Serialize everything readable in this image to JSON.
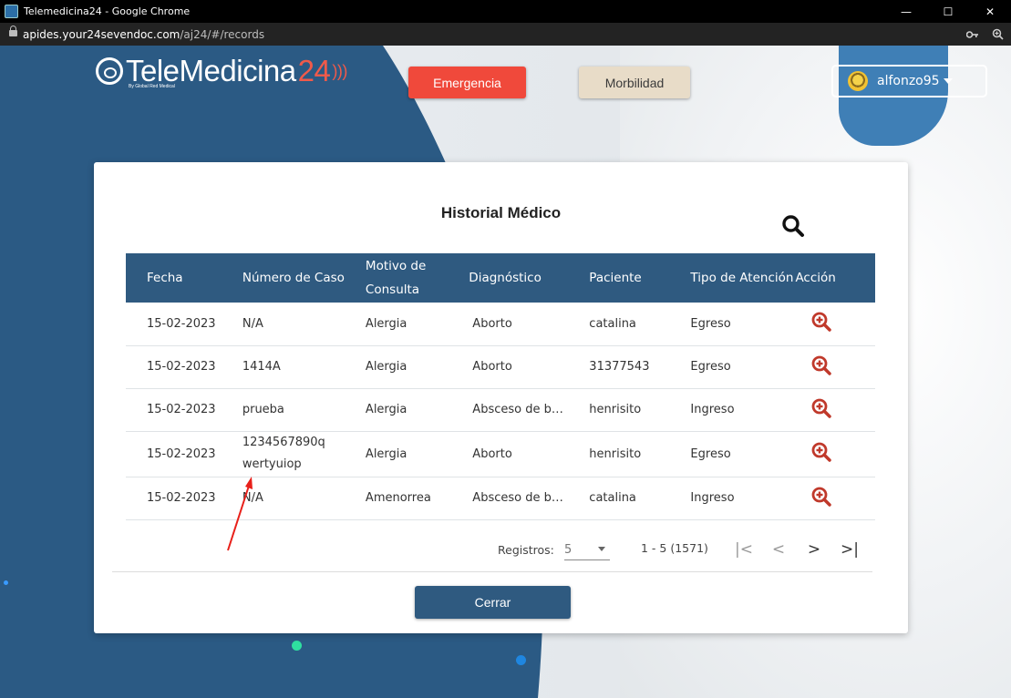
{
  "window": {
    "title": "Telemedicina24 - Google Chrome",
    "controls": {
      "minimize": "—",
      "maximize": "☐",
      "close": "✕"
    }
  },
  "urlbar": {
    "host": "apides.your24sevendoc.com",
    "path": "/aj24/#/records",
    "icons": [
      "key-icon",
      "zoom-icon"
    ]
  },
  "header": {
    "logo_text": "TeleMedicina",
    "logo_number": "24",
    "logo_tagline": "By Global Red Medical",
    "emergency_label": "Emergencia",
    "morbilidad_label": "Morbilidad",
    "username": "alfonzo95"
  },
  "modal": {
    "title": "Historial Médico",
    "columns": [
      "Fecha",
      "Número de Caso",
      "Motivo de Consulta",
      "Diagnóstico",
      "Paciente",
      "Tipo de Atención",
      "Acción"
    ],
    "rows": [
      {
        "fecha": "15-02-2023",
        "caso": "N/A",
        "motivo": "Alergia",
        "diagnostico": "Aborto",
        "paciente": "catalina",
        "tipo": "Egreso"
      },
      {
        "fecha": "15-02-2023",
        "caso": "1414A",
        "motivo": "Alergia",
        "diagnostico": "Aborto",
        "paciente": "31377543",
        "tipo": "Egreso"
      },
      {
        "fecha": "15-02-2023",
        "caso": "prueba",
        "motivo": "Alergia",
        "diagnostico": "Absceso de ba...",
        "paciente": "henrisito",
        "tipo": "Ingreso"
      },
      {
        "fecha": "15-02-2023",
        "caso": "1234567890qwertyuiop",
        "motivo": "Alergia",
        "diagnostico": "Aborto",
        "paciente": "henrisito",
        "tipo": "Egreso"
      },
      {
        "fecha": "15-02-2023",
        "caso": "N/A",
        "motivo": "Amenorrea",
        "diagnostico": "Absceso de ba...",
        "paciente": "catalina",
        "tipo": "Ingreso"
      }
    ],
    "pagination": {
      "registros_label": "Registros:",
      "page_size": "5",
      "range": "1 - 5 (1571)",
      "first": "|<",
      "prev": "<",
      "next": ">",
      "last": ">|"
    },
    "close_label": "Cerrar"
  },
  "colors": {
    "navy": "#2f5a80",
    "emergency": "#f0493b",
    "morbilidad": "#e8dcc8",
    "action_icon": "#c0392b",
    "annotation_arrow": "#e8201a"
  }
}
